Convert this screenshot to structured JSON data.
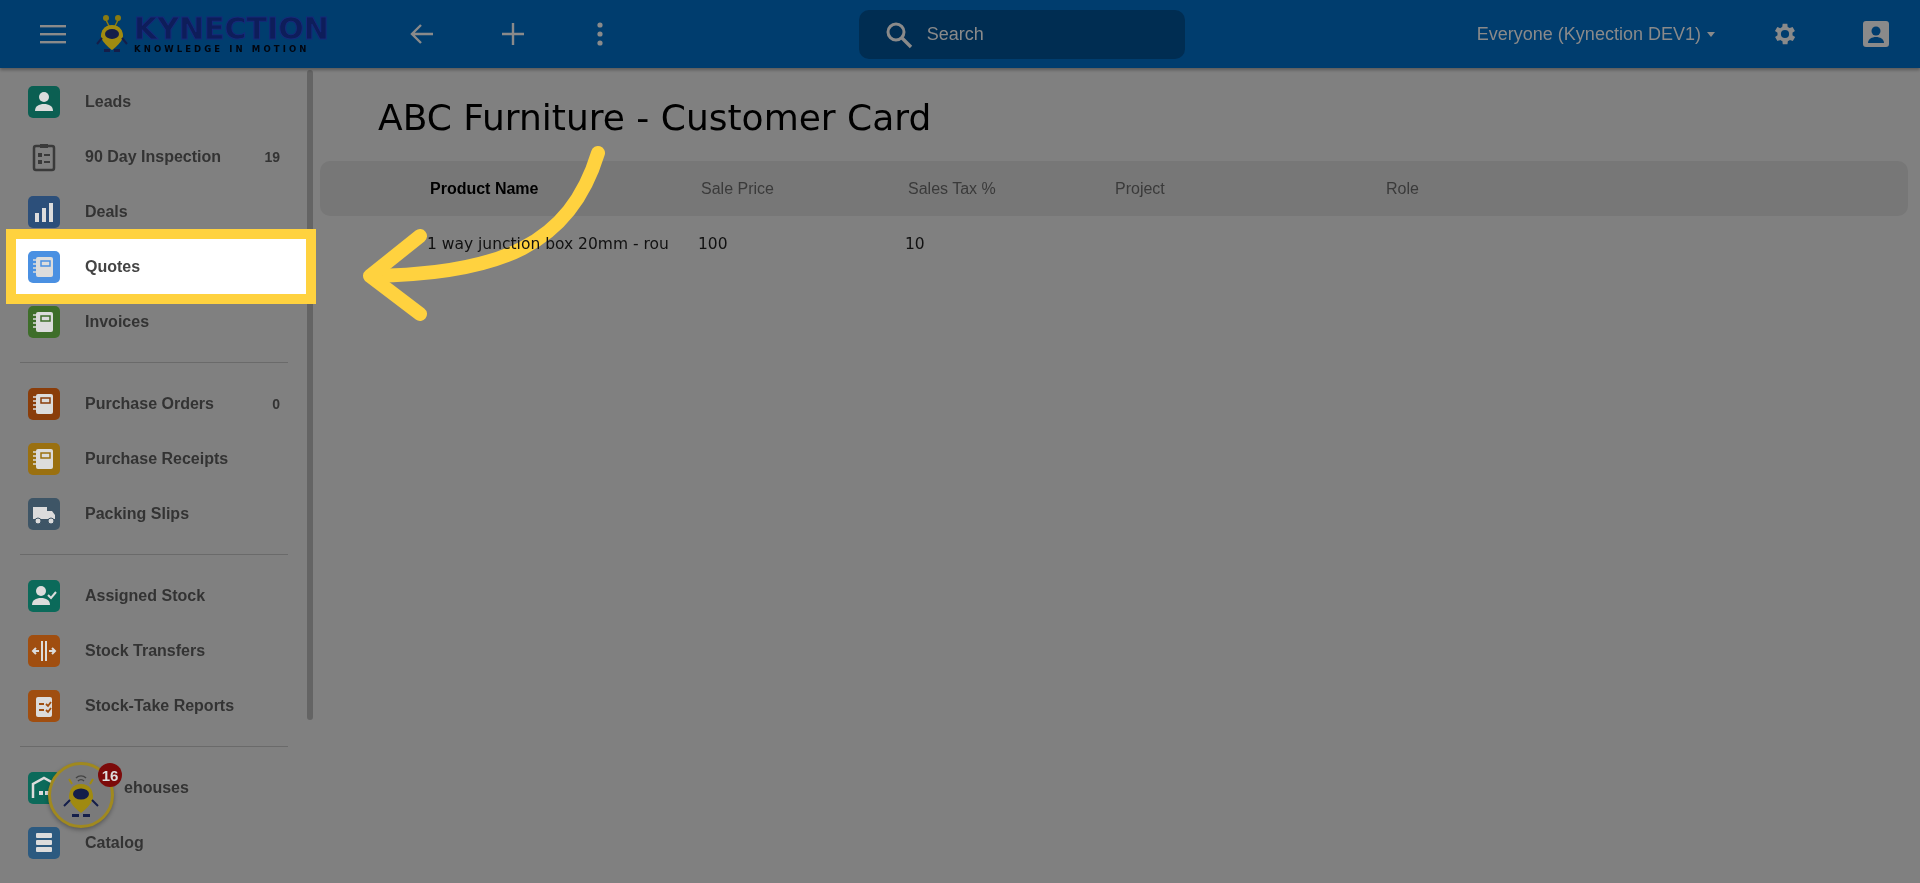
{
  "topbar": {
    "logo": {
      "word": "KYNECTION",
      "tagline": "KNOWLEDGE IN MOTION"
    },
    "search": {
      "placeholder": "Search"
    },
    "account_menu": "Everyone (Kynection DEV1)"
  },
  "sidebar": {
    "sections": [
      {
        "items": [
          {
            "label": "Leads",
            "kind": "person",
            "color": "#0b5f52",
            "selected": false
          },
          {
            "label": "90 Day Inspection",
            "kind": "clipboard",
            "color": "#3a3a3a",
            "count": "19",
            "selected": false
          },
          {
            "label": "Deals",
            "kind": "chart",
            "color": "#2c4f7a",
            "selected": false
          },
          {
            "label": "Quotes",
            "kind": "notebook",
            "color": "#4a90e2",
            "selected": true
          },
          {
            "label": "Invoices",
            "kind": "notebook",
            "color": "#3e6e2a",
            "selected": false
          }
        ]
      },
      {
        "items": [
          {
            "label": "Purchase Orders",
            "kind": "notebook",
            "color": "#8a3d0a",
            "count": "0",
            "selected": false
          },
          {
            "label": "Purchase Receipts",
            "kind": "notebook",
            "color": "#9a7010",
            "selected": false
          },
          {
            "label": "Packing Slips",
            "kind": "truck",
            "color": "#3e5566",
            "selected": false
          }
        ]
      },
      {
        "items": [
          {
            "label": "Assigned Stock",
            "kind": "person-check",
            "color": "#0b6a5a",
            "selected": false
          },
          {
            "label": "Stock Transfers",
            "kind": "transfer",
            "color": "#a04e10",
            "selected": false
          },
          {
            "label": "Stock-Take Reports",
            "kind": "checklist",
            "color": "#a04e10",
            "selected": false
          }
        ]
      },
      {
        "items": [
          {
            "label": "ehouses",
            "kind": "warehouse",
            "color": "#0b6a5a",
            "selected": false,
            "clipped": true
          },
          {
            "label": "Catalog",
            "kind": "catalog",
            "color": "#2c5a80",
            "selected": false
          }
        ]
      }
    ]
  },
  "assistant": {
    "badge": "16"
  },
  "page": {
    "title": "ABC Furniture - Customer Card"
  },
  "table": {
    "columns": [
      "Product Name",
      "Sale Price",
      "Sales Tax %",
      "Project",
      "Role"
    ],
    "rows": [
      {
        "cells": [
          "1 way junction box 20mm - rou",
          "100",
          "10"
        ]
      }
    ]
  }
}
